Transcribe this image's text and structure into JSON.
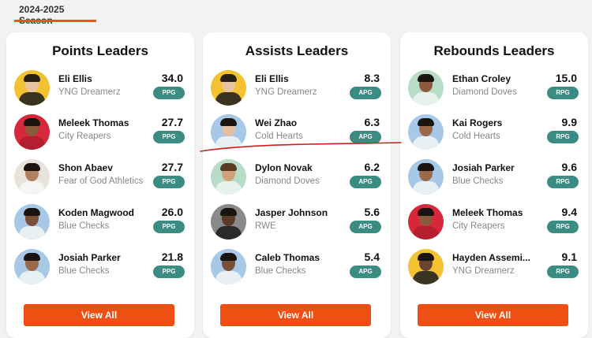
{
  "season": {
    "label": "2024-2025 Season"
  },
  "colors": {
    "accent": "#ee4f12",
    "badge": "#3b8c82",
    "underline": "#e8551e"
  },
  "cards": [
    {
      "title": "Points Leaders",
      "view_all": "View All",
      "players": [
        {
          "name": "Eli Ellis",
          "team": "YNG Dreamerz",
          "value": "34.0",
          "unit": "PPG"
        },
        {
          "name": "Meleek Thomas",
          "team": "City Reapers",
          "value": "27.7",
          "unit": "PPG"
        },
        {
          "name": "Shon Abaev",
          "team": "Fear of God Athletics",
          "value": "27.7",
          "unit": "PPG"
        },
        {
          "name": "Koden Magwood",
          "team": "Blue Checks",
          "value": "26.0",
          "unit": "PPG"
        },
        {
          "name": "Josiah Parker",
          "team": "Blue Checks",
          "value": "21.8",
          "unit": "PPG"
        }
      ]
    },
    {
      "title": "Assists Leaders",
      "view_all": "View All",
      "players": [
        {
          "name": "Eli Ellis",
          "team": "YNG Dreamerz",
          "value": "8.3",
          "unit": "APG"
        },
        {
          "name": "Wei Zhao",
          "team": "Cold Hearts",
          "value": "6.3",
          "unit": "APG"
        },
        {
          "name": "Dylon Novak",
          "team": "Diamond Doves",
          "value": "6.2",
          "unit": "APG"
        },
        {
          "name": "Jasper Johnson",
          "team": "RWE",
          "value": "5.6",
          "unit": "APG"
        },
        {
          "name": "Caleb Thomas",
          "team": "Blue Checks",
          "value": "5.4",
          "unit": "APG"
        }
      ]
    },
    {
      "title": "Rebounds Leaders",
      "view_all": "View All",
      "players": [
        {
          "name": "Ethan Croley",
          "team": "Diamond Doves",
          "value": "15.0",
          "unit": "RPG"
        },
        {
          "name": "Kai Rogers",
          "team": "Cold Hearts",
          "value": "9.9",
          "unit": "RPG"
        },
        {
          "name": "Josiah Parker",
          "team": "Blue Checks",
          "value": "9.6",
          "unit": "RPG"
        },
        {
          "name": "Meleek Thomas",
          "team": "City Reapers",
          "value": "9.4",
          "unit": "RPG"
        },
        {
          "name": "Hayden Assemi...",
          "team": "YNG Dreamerz",
          "value": "9.1",
          "unit": "RPG"
        }
      ]
    }
  ]
}
